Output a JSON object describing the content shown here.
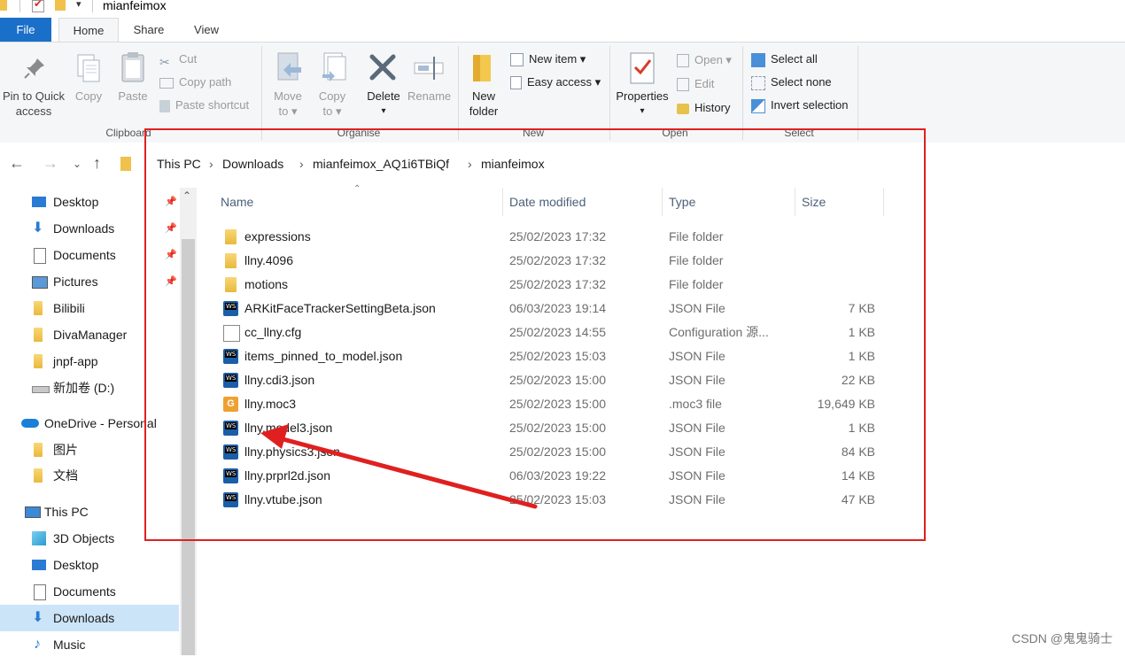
{
  "window": {
    "title": "mianfeimox"
  },
  "tabs": [
    "File",
    "Home",
    "Share",
    "View"
  ],
  "ribbon": {
    "clipboard": {
      "group_label": "Clipboard",
      "pin_label_1": "Pin to Quick",
      "pin_label_2": "access",
      "copy": "Copy",
      "paste": "Paste",
      "cut": "Cut",
      "copy_path": "Copy path",
      "paste_shortcut": "Paste shortcut"
    },
    "organise": {
      "group_label": "Organise",
      "move_to_1": "Move",
      "move_to_2": "to ▾",
      "copy_to_1": "Copy",
      "copy_to_2": "to ▾",
      "delete": "Delete",
      "delete_arrow": "▾",
      "rename": "Rename"
    },
    "new": {
      "group_label": "New",
      "new_folder_1": "New",
      "new_folder_2": "folder",
      "new_item": "New item ▾",
      "easy_access": "Easy access ▾"
    },
    "open": {
      "group_label": "Open",
      "properties": "Properties",
      "properties_arrow": "▾",
      "open": "Open ▾",
      "edit": "Edit",
      "history": "History"
    },
    "select": {
      "group_label": "Select",
      "select_all": "Select all",
      "select_none": "Select none",
      "invert_selection": "Invert selection"
    }
  },
  "address": {
    "crumbs": [
      "This PC",
      "Downloads",
      "mianfeimox_AQ1i6TBiQf",
      "mianfeimox"
    ]
  },
  "sidebar": {
    "quick_access": [
      {
        "label": "Desktop",
        "pinned": true
      },
      {
        "label": "Downloads",
        "pinned": true
      },
      {
        "label": "Documents",
        "pinned": true
      },
      {
        "label": "Pictures",
        "pinned": true
      },
      {
        "label": "Bilibili",
        "pinned": false
      },
      {
        "label": "DivaManager",
        "pinned": false
      },
      {
        "label": "jnpf-app",
        "pinned": false
      },
      {
        "label": "新加卷 (D:)",
        "pinned": false
      }
    ],
    "onedrive": {
      "label": "OneDrive - Personal",
      "children": [
        "图片",
        "文档"
      ]
    },
    "this_pc": {
      "label": "This PC",
      "children": [
        "3D Objects",
        "Desktop",
        "Documents",
        "Downloads",
        "Music"
      ]
    }
  },
  "columns": {
    "name": "Name",
    "date": "Date modified",
    "type": "Type",
    "size": "Size"
  },
  "files": [
    {
      "name": "expressions",
      "date": "25/02/2023 17:32",
      "type": "File folder",
      "size": "",
      "icon": "folder-icon"
    },
    {
      "name": "llny.4096",
      "date": "25/02/2023 17:32",
      "type": "File folder",
      "size": "",
      "icon": "folder-icon"
    },
    {
      "name": "motions",
      "date": "25/02/2023 17:32",
      "type": "File folder",
      "size": "",
      "icon": "folder-icon"
    },
    {
      "name": "ARKitFaceTrackerSettingBeta.json",
      "date": "06/03/2023 19:14",
      "type": "JSON File",
      "size": "7 KB",
      "icon": "webstorm-json-icon"
    },
    {
      "name": "cc_llny.cfg",
      "date": "25/02/2023 14:55",
      "type": "Configuration 源...",
      "size": "1 KB",
      "icon": "config-file-icon"
    },
    {
      "name": "items_pinned_to_model.json",
      "date": "25/02/2023 15:03",
      "type": "JSON File",
      "size": "1 KB",
      "icon": "webstorm-json-icon"
    },
    {
      "name": "llny.cdi3.json",
      "date": "25/02/2023 15:00",
      "type": "JSON File",
      "size": "22 KB",
      "icon": "webstorm-json-icon"
    },
    {
      "name": "llny.moc3",
      "date": "25/02/2023 15:00",
      "type": ".moc3 file",
      "size": "19,649 KB",
      "icon": "moc3-file-icon"
    },
    {
      "name": "llny.model3.json",
      "date": "25/02/2023 15:00",
      "type": "JSON File",
      "size": "1 KB",
      "icon": "webstorm-json-icon"
    },
    {
      "name": "llny.physics3.json",
      "date": "25/02/2023 15:00",
      "type": "JSON File",
      "size": "84 KB",
      "icon": "webstorm-json-icon"
    },
    {
      "name": "llny.prprl2d.json",
      "date": "06/03/2023 19:22",
      "type": "JSON File",
      "size": "14 KB",
      "icon": "webstorm-json-icon"
    },
    {
      "name": "llny.vtube.json",
      "date": "25/02/2023 15:03",
      "type": "JSON File",
      "size": "47 KB",
      "icon": "webstorm-json-icon"
    }
  ],
  "watermark": "CSDN @鬼鬼骑士",
  "annotation_color": "#e02020"
}
